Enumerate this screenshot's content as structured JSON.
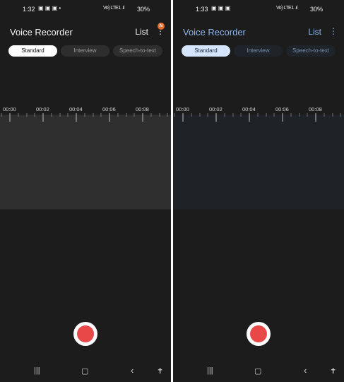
{
  "left": {
    "status": {
      "time": "1:32",
      "battery": "30%",
      "signal": "Vo) LTE1 .ıl"
    },
    "app_title": "Voice Recorder",
    "list_label": "List",
    "badge": "N",
    "tabs": [
      "Standard",
      "Interview",
      "Speech-to-text"
    ],
    "timeline": [
      "00:00",
      "00:02",
      "00:04",
      "00:06",
      "00:08"
    ]
  },
  "right": {
    "status": {
      "time": "1:33",
      "battery": "30%",
      "signal": "Vo) LTE1 .ıl"
    },
    "app_title": "Voice Recorder",
    "list_label": "List",
    "tabs": [
      "Standard",
      "Interview",
      "Speech-to-text"
    ],
    "timeline": [
      "00:00",
      "00:02",
      "00:04",
      "00:06",
      "00:08"
    ]
  },
  "icons": {
    "menu": "more-vertical-icon",
    "record": "record-icon",
    "nav_recent": "recents-icon",
    "nav_home": "home-icon",
    "nav_back": "back-icon",
    "nav_access": "accessibility-icon"
  },
  "colors": {
    "bg": "#1c1c1c",
    "wave_left": "#2f2f2f",
    "wave_right": "#1f2328",
    "record": "#e84848",
    "accent_right": "#8fb3e8",
    "tab_selected_left": "#ffffff",
    "tab_selected_right": "#d5e5fb"
  }
}
